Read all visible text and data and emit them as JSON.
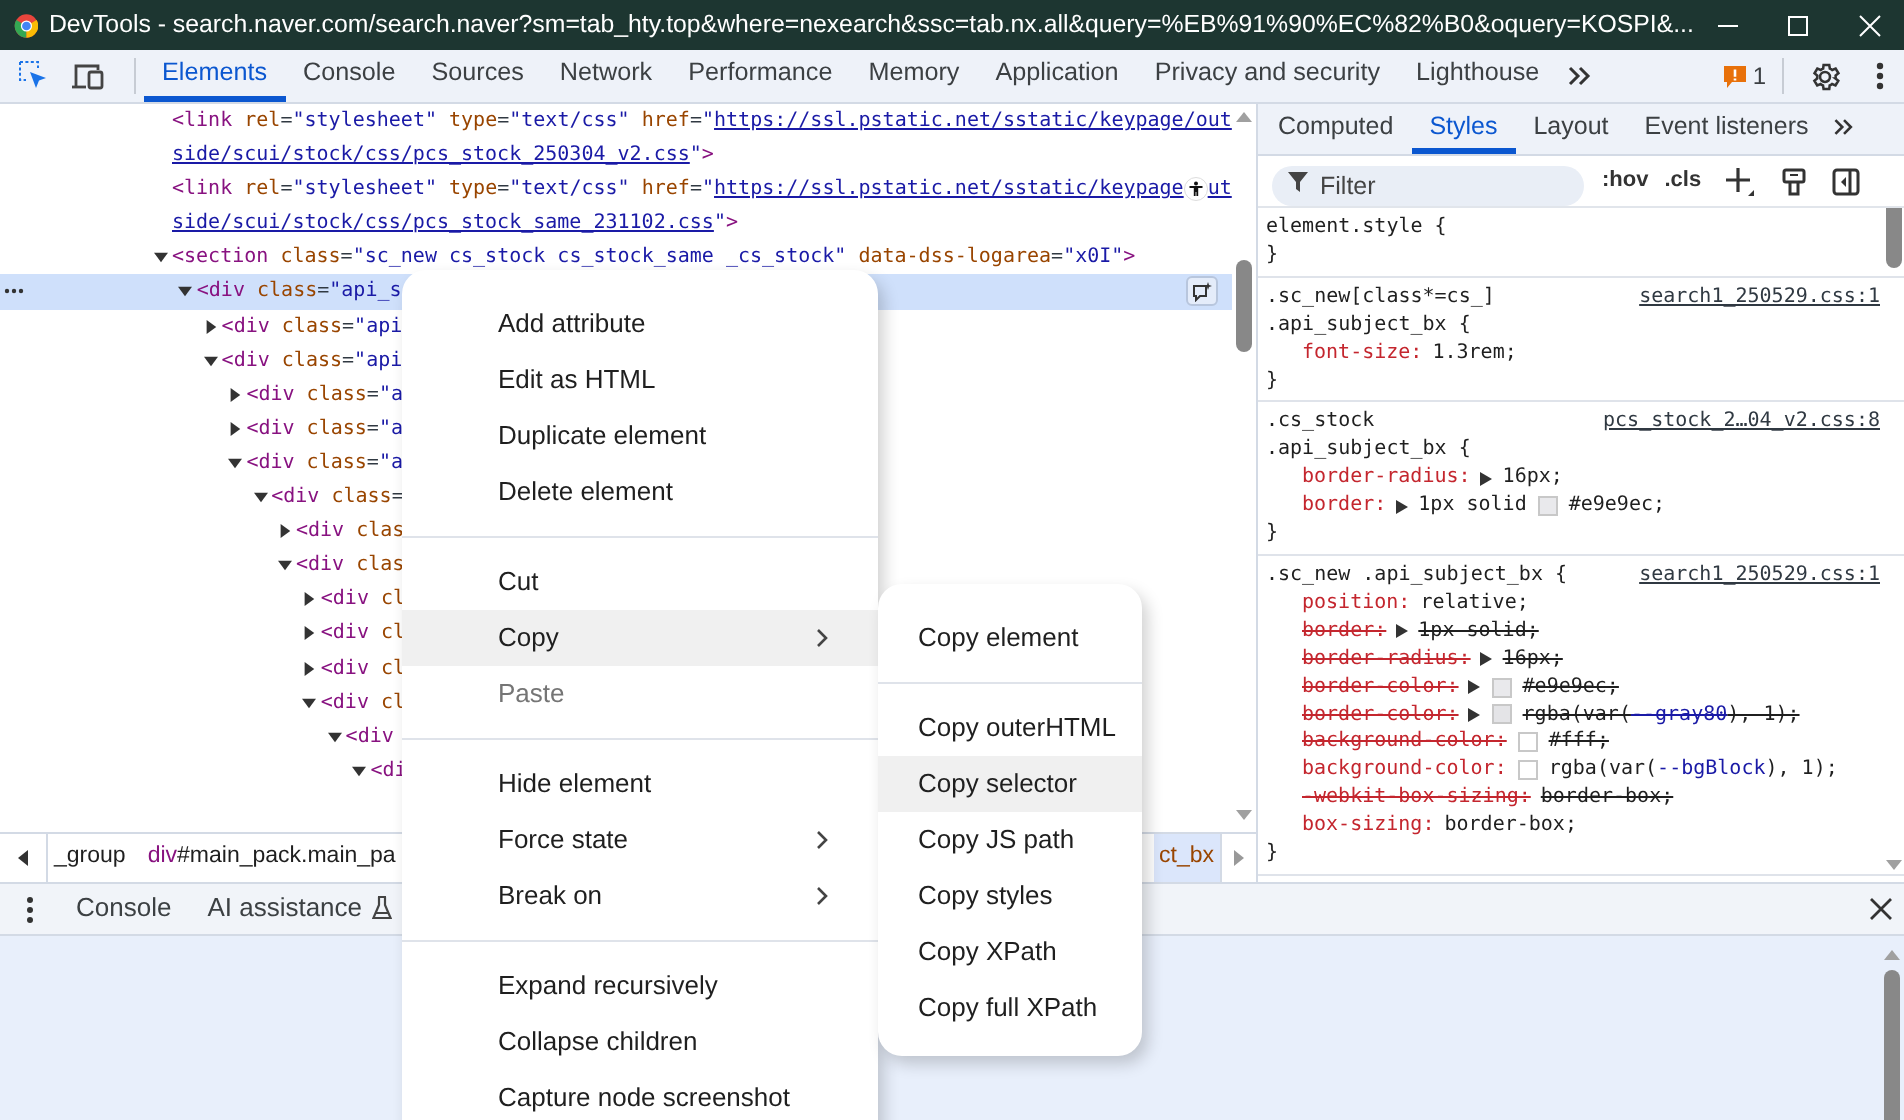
{
  "window": {
    "title": "DevTools - search.naver.com/search.naver?sm=tab_hty.top&where=nexearch&ssc=tab.nx.all&query=%EB%91%90%EC%82%B0&oquery=KOSPI&..."
  },
  "toolbar": {
    "tabs": [
      {
        "label": "Elements",
        "selected": true
      },
      {
        "label": "Console",
        "selected": false
      },
      {
        "label": "Sources",
        "selected": false
      },
      {
        "label": "Network",
        "selected": false
      },
      {
        "label": "Performance",
        "selected": false
      },
      {
        "label": "Memory",
        "selected": false
      },
      {
        "label": "Application",
        "selected": false
      },
      {
        "label": "Privacy and security",
        "selected": false
      },
      {
        "label": "Lighthouse",
        "selected": false
      }
    ],
    "issues_count": "1"
  },
  "elements_tree": {
    "nodes": [
      {
        "selected": false,
        "lines": [
          [
            {
              "kind": "tag",
              "text": "<link"
            },
            {
              "kind": "attr",
              "text": " rel"
            },
            {
              "kind": "eq",
              "text": "="
            },
            {
              "kind": "val",
              "text": "\"stylesheet\""
            },
            {
              "kind": "attr",
              "text": " type"
            },
            {
              "kind": "eq",
              "text": "="
            },
            {
              "kind": "val",
              "text": "\"text/css\""
            },
            {
              "kind": "attr",
              "text": " href"
            },
            {
              "kind": "eq",
              "text": "="
            },
            {
              "kind": "val",
              "text": "\""
            },
            {
              "kind": "link",
              "text": "https://ssl.pstatic.net/sstatic/keypage/out"
            }
          ],
          [
            {
              "kind": "link",
              "text": "side/scui/stock/css/pcs_stock_250304_v2.css"
            },
            {
              "kind": "val",
              "text": "\""
            },
            {
              "kind": "tag",
              "text": ">"
            }
          ]
        ]
      },
      {
        "selected": false,
        "lines": [
          [
            {
              "kind": "tag",
              "text": "<link"
            },
            {
              "kind": "attr",
              "text": " rel"
            },
            {
              "kind": "eq",
              "text": "="
            },
            {
              "kind": "val",
              "text": "\"stylesheet\""
            },
            {
              "kind": "attr",
              "text": " type"
            },
            {
              "kind": "eq",
              "text": "="
            },
            {
              "kind": "val",
              "text": "\"text/css\""
            },
            {
              "kind": "attr",
              "text": " href"
            },
            {
              "kind": "eq",
              "text": "="
            },
            {
              "kind": "val",
              "text": "\""
            },
            {
              "kind": "link",
              "text": "https://ssl.pstatic.net/sstatic/keypage"
            },
            {
              "kind": "link",
              "text": "ut",
              "covered": true
            }
          ],
          [
            {
              "kind": "link",
              "text": "side/scui/stock/css/pcs_stock_same_231102.css"
            },
            {
              "kind": "val",
              "text": "\""
            },
            {
              "kind": "tag",
              "text": ">"
            }
          ]
        ]
      },
      {
        "selected": false,
        "expanded": true,
        "lines": [
          [
            {
              "kind": "tag",
              "text": "<section"
            },
            {
              "kind": "attr",
              "text": " class"
            },
            {
              "kind": "eq",
              "text": "="
            },
            {
              "kind": "val",
              "text": "\"sc_new cs_stock cs_stock_same _cs_stock\""
            },
            {
              "kind": "attr",
              "text": " data-dss-logarea"
            },
            {
              "kind": "eq",
              "text": "="
            },
            {
              "kind": "val",
              "text": "\"x0I\""
            },
            {
              "kind": "tag",
              "text": ">"
            }
          ]
        ],
        "children": [
          {
            "selected": true,
            "expanded": true,
            "lines": [
              [
                {
                  "kind": "tag",
                  "text": "<div"
                },
                {
                  "kind": "attr",
                  "text": " class"
                },
                {
                  "kind": "eq",
                  "text": "="
                },
                {
                  "kind": "val",
                  "text": "\"api_s"
                }
              ]
            ],
            "children": [
              {
                "selected": false,
                "expanded": false,
                "lines": [
                  [
                    {
                      "kind": "tag",
                      "text": "<div"
                    },
                    {
                      "kind": "attr",
                      "text": " class"
                    },
                    {
                      "kind": "eq",
                      "text": "="
                    },
                    {
                      "kind": "val",
                      "text": "\"api"
                    }
                  ]
                ]
              },
              {
                "selected": false,
                "expanded": true,
                "lines": [
                  [
                    {
                      "kind": "tag",
                      "text": "<div"
                    },
                    {
                      "kind": "attr",
                      "text": " class"
                    },
                    {
                      "kind": "eq",
                      "text": "="
                    },
                    {
                      "kind": "val",
                      "text": "\"api"
                    }
                  ]
                ],
                "children": [
                  {
                    "selected": false,
                    "expanded": false,
                    "lines": [
                      [
                        {
                          "kind": "tag",
                          "text": "<div"
                        },
                        {
                          "kind": "attr",
                          "text": " class"
                        },
                        {
                          "kind": "eq",
                          "text": "="
                        },
                        {
                          "kind": "val",
                          "text": "\"a"
                        }
                      ]
                    ]
                  },
                  {
                    "selected": false,
                    "expanded": false,
                    "lines": [
                      [
                        {
                          "kind": "tag",
                          "text": "<div"
                        },
                        {
                          "kind": "attr",
                          "text": " class"
                        },
                        {
                          "kind": "eq",
                          "text": "="
                        },
                        {
                          "kind": "val",
                          "text": "\"a"
                        }
                      ]
                    ]
                  },
                  {
                    "selected": false,
                    "expanded": true,
                    "lines": [
                      [
                        {
                          "kind": "tag",
                          "text": "<div"
                        },
                        {
                          "kind": "attr",
                          "text": " class"
                        },
                        {
                          "kind": "eq",
                          "text": "="
                        },
                        {
                          "kind": "val",
                          "text": "\"a"
                        }
                      ]
                    ],
                    "children": [
                      {
                        "selected": false,
                        "expanded": true,
                        "lines": [
                          [
                            {
                              "kind": "tag",
                              "text": "<div"
                            },
                            {
                              "kind": "attr",
                              "text": " class"
                            },
                            {
                              "kind": "eq",
                              "text": "="
                            }
                          ]
                        ],
                        "children": [
                          {
                            "selected": false,
                            "expanded": false,
                            "lines": [
                              [
                                {
                                  "kind": "tag",
                                  "text": "<div"
                                },
                                {
                                  "kind": "attr",
                                  "text": " clas"
                                }
                              ]
                            ]
                          },
                          {
                            "selected": false,
                            "expanded": true,
                            "lines": [
                              [
                                {
                                  "kind": "tag",
                                  "text": "<div"
                                },
                                {
                                  "kind": "attr",
                                  "text": " clas"
                                }
                              ]
                            ],
                            "children": [
                              {
                                "selected": false,
                                "expanded": false,
                                "lines": [
                                  [
                                    {
                                      "kind": "tag",
                                      "text": "<div"
                                    },
                                    {
                                      "kind": "attr",
                                      "text": " cl"
                                    }
                                  ]
                                ]
                              },
                              {
                                "selected": false,
                                "expanded": false,
                                "lines": [
                                  [
                                    {
                                      "kind": "tag",
                                      "text": "<div"
                                    },
                                    {
                                      "kind": "attr",
                                      "text": " cl"
                                    }
                                  ]
                                ]
                              },
                              {
                                "selected": false,
                                "expanded": false,
                                "lines": [
                                  [
                                    {
                                      "kind": "tag",
                                      "text": "<div"
                                    },
                                    {
                                      "kind": "attr",
                                      "text": " cl"
                                    }
                                  ]
                                ]
                              },
                              {
                                "selected": false,
                                "expanded": true,
                                "lines": [
                                  [
                                    {
                                      "kind": "tag",
                                      "text": "<div"
                                    },
                                    {
                                      "kind": "attr",
                                      "text": " cl"
                                    }
                                  ]
                                ],
                                "children": [
                                  {
                                    "selected": false,
                                    "expanded": true,
                                    "lines": [
                                      [
                                        {
                                          "kind": "tag",
                                          "text": "<div"
                                        }
                                      ]
                                    ],
                                    "children": [
                                      {
                                        "selected": false,
                                        "expanded": true,
                                        "lines": [
                                          [
                                            {
                                              "kind": "tag",
                                              "text": "<di"
                                            }
                                          ]
                                        ]
                                      }
                                    ]
                                  }
                                ]
                              }
                            ]
                          }
                        ]
                      }
                    ]
                  }
                ]
              }
            ]
          }
        ]
      }
    ]
  },
  "breadcrumbs": [
    {
      "rest": "_group",
      "selected": false
    },
    {
      "tag": "div",
      "rest": "#main_pack.main_pa",
      "selected": false
    },
    {
      "rest": "ct_bx",
      "selected": true
    }
  ],
  "styles_pane": {
    "tabs": [
      {
        "label": "Computed",
        "selected": false
      },
      {
        "label": "Styles",
        "selected": true
      },
      {
        "label": "Layout",
        "selected": false
      },
      {
        "label": "Event listeners",
        "selected": false
      }
    ],
    "filter": {
      "placeholder": "Filter"
    },
    "hov": ":hov",
    "cls": ".cls",
    "rules": [
      {
        "selectors": [
          "element.style {"
        ],
        "close": "}"
      },
      {
        "selectors": [
          ".sc_new[class*=cs_]",
          ".api_subject_bx {"
        ],
        "source": "search1_250529.css:1",
        "declarations": [
          {
            "property": "font-size:",
            "arrow": false,
            "value": [
              {
                "kind": "text",
                "text": "1.3rem;"
              }
            ],
            "struck": false
          }
        ],
        "close": "}"
      },
      {
        "selectors": [
          ".cs_stock",
          ".api_subject_bx {"
        ],
        "source": "pcs_stock_2…04_v2.css:8",
        "declarations": [
          {
            "property": "border-radius:",
            "arrow": true,
            "value": [
              {
                "kind": "text",
                "text": "16px;"
              }
            ],
            "struck": false
          },
          {
            "property": "border:",
            "arrow": true,
            "value": [
              {
                "kind": "text",
                "text": "1px solid"
              },
              {
                "kind": "swatch",
                "color": "#e9e9ec"
              },
              {
                "kind": "text",
                "text": "#e9e9ec;"
              }
            ],
            "struck": false
          }
        ],
        "close": "}"
      },
      {
        "selectors": [
          ".sc_new .api_subject_bx {"
        ],
        "source": "search1_250529.css:1",
        "declarations": [
          {
            "property": "position:",
            "arrow": false,
            "value": [
              {
                "kind": "text",
                "text": "relative;"
              }
            ],
            "struck": false
          },
          {
            "property": "border:",
            "arrow": true,
            "value": [
              {
                "kind": "text",
                "text": "1px solid;"
              }
            ],
            "struck": true
          },
          {
            "property": "border-radius:",
            "arrow": true,
            "value": [
              {
                "kind": "text",
                "text": "16px;"
              }
            ],
            "struck": true
          },
          {
            "property": "border-color:",
            "arrow": true,
            "value": [
              {
                "kind": "swatch",
                "color": "#e9e9ec"
              },
              {
                "kind": "text",
                "text": "#e9e9ec;"
              }
            ],
            "struck": true
          },
          {
            "property": "border-color:",
            "arrow": true,
            "value": [
              {
                "kind": "swatch",
                "color": "#e4e4e7"
              },
              {
                "kind": "text",
                "text": "rgba(var("
              },
              {
                "kind": "var",
                "text": "--gray80"
              },
              {
                "kind": "text",
                "text": "), 1);"
              }
            ],
            "struck": true
          },
          {
            "property": "background-color:",
            "arrow": false,
            "value": [
              {
                "kind": "swatch",
                "color": "#ffffff"
              },
              {
                "kind": "text",
                "text": "#fff;"
              }
            ],
            "struck": true
          },
          {
            "property": "background-color:",
            "arrow": false,
            "value": [
              {
                "kind": "swatch",
                "color": "#ffffff"
              },
              {
                "kind": "text",
                "text": "rgba(var("
              },
              {
                "kind": "var",
                "text": "--bgBlock"
              },
              {
                "kind": "text",
                "text": "), 1);"
              }
            ],
            "struck": false
          },
          {
            "property": "-webkit-box-sizing:",
            "arrow": false,
            "value": [
              {
                "kind": "text",
                "text": "border-box;"
              }
            ],
            "struck": true
          },
          {
            "property": "box-sizing:",
            "arrow": false,
            "value": [
              {
                "kind": "text",
                "text": "border-box;"
              }
            ],
            "struck": false
          }
        ],
        "close": "}"
      }
    ]
  },
  "drawer": {
    "tabs": [
      {
        "label": "Console",
        "selected": false,
        "experimental": false
      },
      {
        "label": "AI assistance",
        "selected": false,
        "experimental": true
      }
    ]
  },
  "context_menu": {
    "groups": [
      [
        {
          "label": "Add attribute",
          "selected": false,
          "disabled": false,
          "submenu": false
        },
        {
          "label": "Edit as HTML",
          "selected": false,
          "disabled": false,
          "submenu": false
        },
        {
          "label": "Duplicate element",
          "selected": false,
          "disabled": false,
          "submenu": false
        },
        {
          "label": "Delete element",
          "selected": false,
          "disabled": false,
          "submenu": false
        }
      ],
      [
        {
          "label": "Cut",
          "selected": false,
          "disabled": false,
          "submenu": false
        },
        {
          "label": "Copy",
          "selected": true,
          "disabled": false,
          "submenu": true
        },
        {
          "label": "Paste",
          "selected": false,
          "disabled": true,
          "submenu": false
        }
      ],
      [
        {
          "label": "Hide element",
          "selected": false,
          "disabled": false,
          "submenu": false
        },
        {
          "label": "Force state",
          "selected": false,
          "disabled": false,
          "submenu": true
        },
        {
          "label": "Break on",
          "selected": false,
          "disabled": false,
          "submenu": true
        }
      ],
      [
        {
          "label": "Expand recursively",
          "selected": false,
          "disabled": false,
          "submenu": false
        },
        {
          "label": "Collapse children",
          "selected": false,
          "disabled": false,
          "submenu": false
        },
        {
          "label": "Capture node screenshot",
          "selected": false,
          "disabled": false,
          "submenu": false
        }
      ]
    ]
  },
  "copy_submenu": {
    "groups": [
      [
        {
          "label": "Copy element",
          "selected": false
        }
      ],
      [
        {
          "label": "Copy outerHTML",
          "selected": false
        },
        {
          "label": "Copy selector",
          "selected": true
        },
        {
          "label": "Copy JS path",
          "selected": false
        },
        {
          "label": "Copy styles",
          "selected": false
        },
        {
          "label": "Copy XPath",
          "selected": false
        },
        {
          "label": "Copy full XPath",
          "selected": false
        }
      ]
    ]
  }
}
